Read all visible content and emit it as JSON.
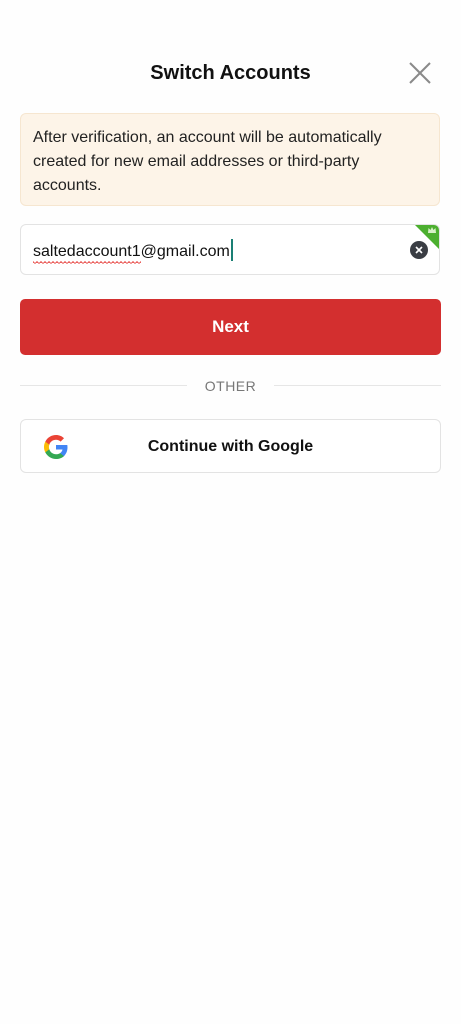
{
  "header": {
    "title": "Switch Accounts",
    "close_icon": "close-icon"
  },
  "notice": {
    "text": "After verification, an account will be automatically created for new email addresses or third-party accounts."
  },
  "email_field": {
    "value_user": "saltedaccount1",
    "value_domain": "@gmail.com",
    "clear_icon": "clear-icon",
    "badge_icon": "crown-icon"
  },
  "next_button": {
    "label": "Next"
  },
  "divider": {
    "label": "OTHER"
  },
  "google_button": {
    "label": "Continue with Google",
    "icon": "google-icon"
  },
  "colors": {
    "primary": "#d32f2f",
    "notice_bg": "#fdf4e8",
    "badge": "#4caf2f",
    "caret": "#1a7f74"
  }
}
